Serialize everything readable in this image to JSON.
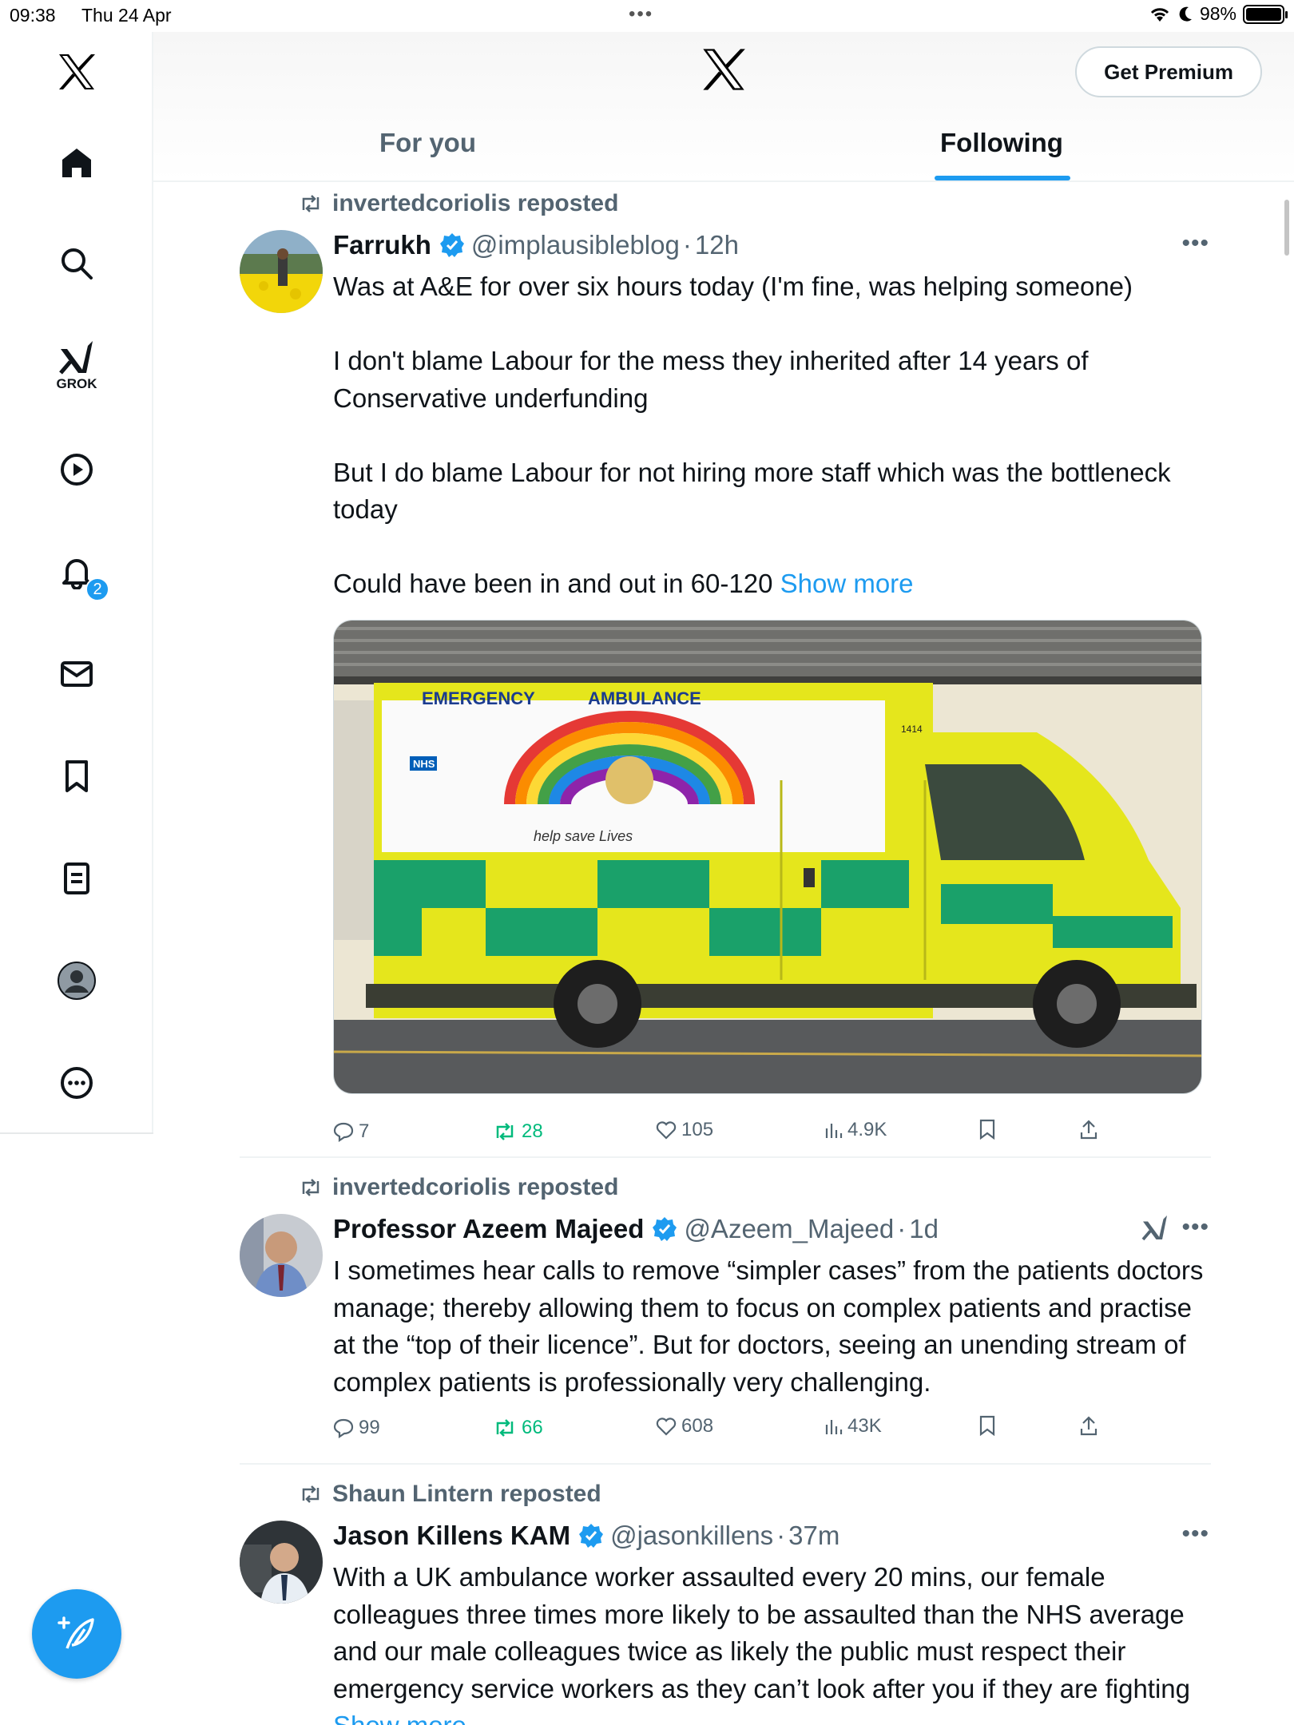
{
  "status_bar": {
    "time": "09:38",
    "date": "Thu 24 Apr",
    "battery": "98%"
  },
  "header": {
    "premium_label": "Get Premium",
    "tabs": [
      {
        "label": "For you"
      },
      {
        "label": "Following"
      }
    ],
    "active_tab": "Following"
  },
  "sidebar": {
    "grok_label": "GROK",
    "notifications_count": "2"
  },
  "posts": [
    {
      "reposted_by": "invertedcoriolis reposted",
      "name": "Farrukh",
      "handle": "@implausibleblog",
      "time": "12h",
      "paragraphs": [
        "Was at A&E for over six hours today (I'm fine, was helping someone)",
        "I don't blame Labour for the mess they inherited after 14 years of Conservative underfunding",
        "But I do blame Labour for not hiring more staff which was the bottleneck today",
        "Could have been in and out in 60-120"
      ],
      "show_more": "Show more",
      "image": {
        "label_left": "EMERGENCY",
        "label_right": "AMBULANCE",
        "nhs": "NHS",
        "vehicle_number": "1414",
        "writing": "help  save  Lives"
      },
      "replies": "7",
      "reposts": "28",
      "likes": "105",
      "views": "4.9K"
    },
    {
      "reposted_by": "invertedcoriolis reposted",
      "name": "Professor Azeem Majeed",
      "handle": "@Azeem_Majeed",
      "time": "1d",
      "paragraphs": [
        "I sometimes hear calls to remove “simpler cases” from the patients doctors manage; thereby allowing them to focus on complex patients and practise at the “top of their licence”. But for doctors, seeing an unending stream of complex patients is professionally very challenging."
      ],
      "replies": "99",
      "reposts": "66",
      "likes": "608",
      "views": "43K"
    },
    {
      "reposted_by": "Shaun Lintern reposted",
      "name": "Jason Killens KAM",
      "handle": "@jasonkillens",
      "time": "37m",
      "paragraphs": [
        "With a UK ambulance worker assaulted every 20 mins, our female colleagues three times more likely to be assaulted than the NHS average and our male colleagues twice as likely the public must respect their emergency service workers as they can’t look after you if they are fighting"
      ],
      "show_more": "Show more"
    }
  ],
  "colors": {
    "accent": "#1d9bf0",
    "repost_green": "#00ba7c",
    "muted": "#536471"
  }
}
